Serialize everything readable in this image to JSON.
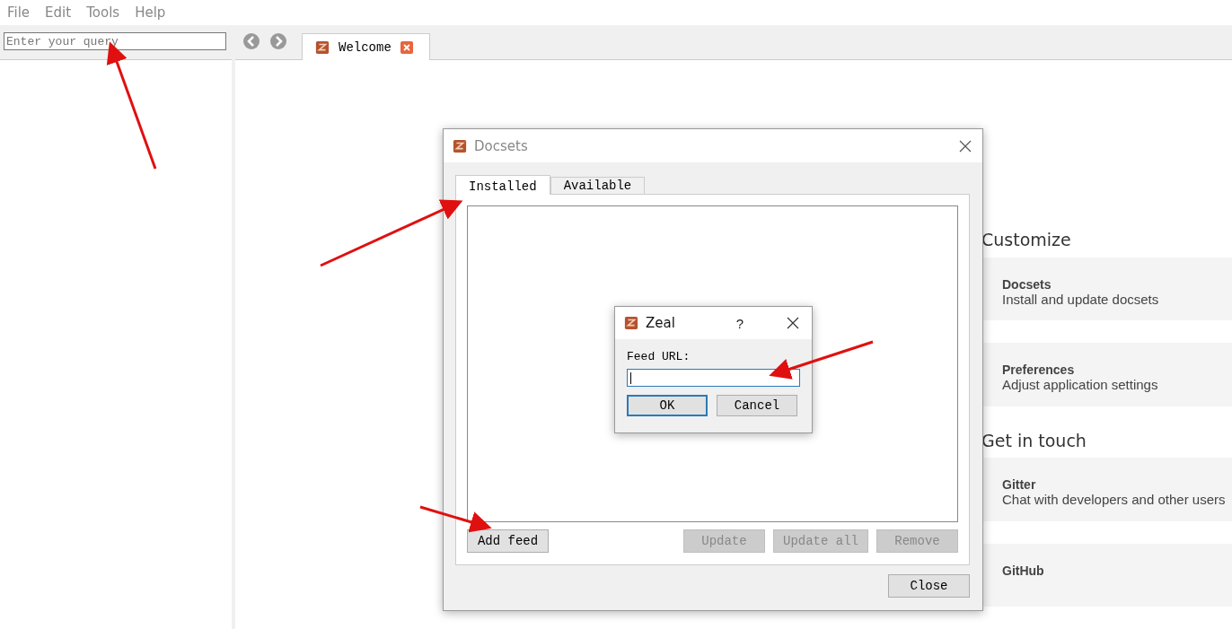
{
  "menu": [
    {
      "label": "File"
    },
    {
      "label": "Edit"
    },
    {
      "label": "Tools"
    },
    {
      "label": "Help"
    }
  ],
  "search": {
    "placeholder": "Enter your query"
  },
  "tabs": [
    {
      "label": "Welcome",
      "selected": true
    }
  ],
  "welcome": [
    {
      "heading": "Customize",
      "cards": [
        {
          "title": "Docsets",
          "subtitle": "Install and update docsets"
        },
        {
          "title": "Preferences",
          "subtitle": "Adjust application settings"
        }
      ]
    },
    {
      "heading": "Get in touch",
      "cards": [
        {
          "title": "Gitter",
          "subtitle": "Chat with developers and other users"
        },
        {
          "title": "GitHub"
        }
      ]
    }
  ],
  "docsets_dialog": {
    "title": "Docsets",
    "tabs": [
      {
        "label": "Installed",
        "selected": true
      },
      {
        "label": "Available",
        "selected": false
      }
    ],
    "left_buttons": [
      {
        "label": "Add feed",
        "disabled": false
      }
    ],
    "right_buttons": [
      {
        "label": "Update",
        "disabled": true
      },
      {
        "label": "Update all",
        "disabled": true
      },
      {
        "label": "Remove",
        "disabled": true
      }
    ],
    "close_button": "Close"
  },
  "feed_dialog": {
    "title": "Zeal",
    "help": "?",
    "field_label": "Feed URL:",
    "buttons": [
      {
        "label": "OK",
        "default": true
      },
      {
        "label": "Cancel",
        "default": false
      }
    ]
  }
}
